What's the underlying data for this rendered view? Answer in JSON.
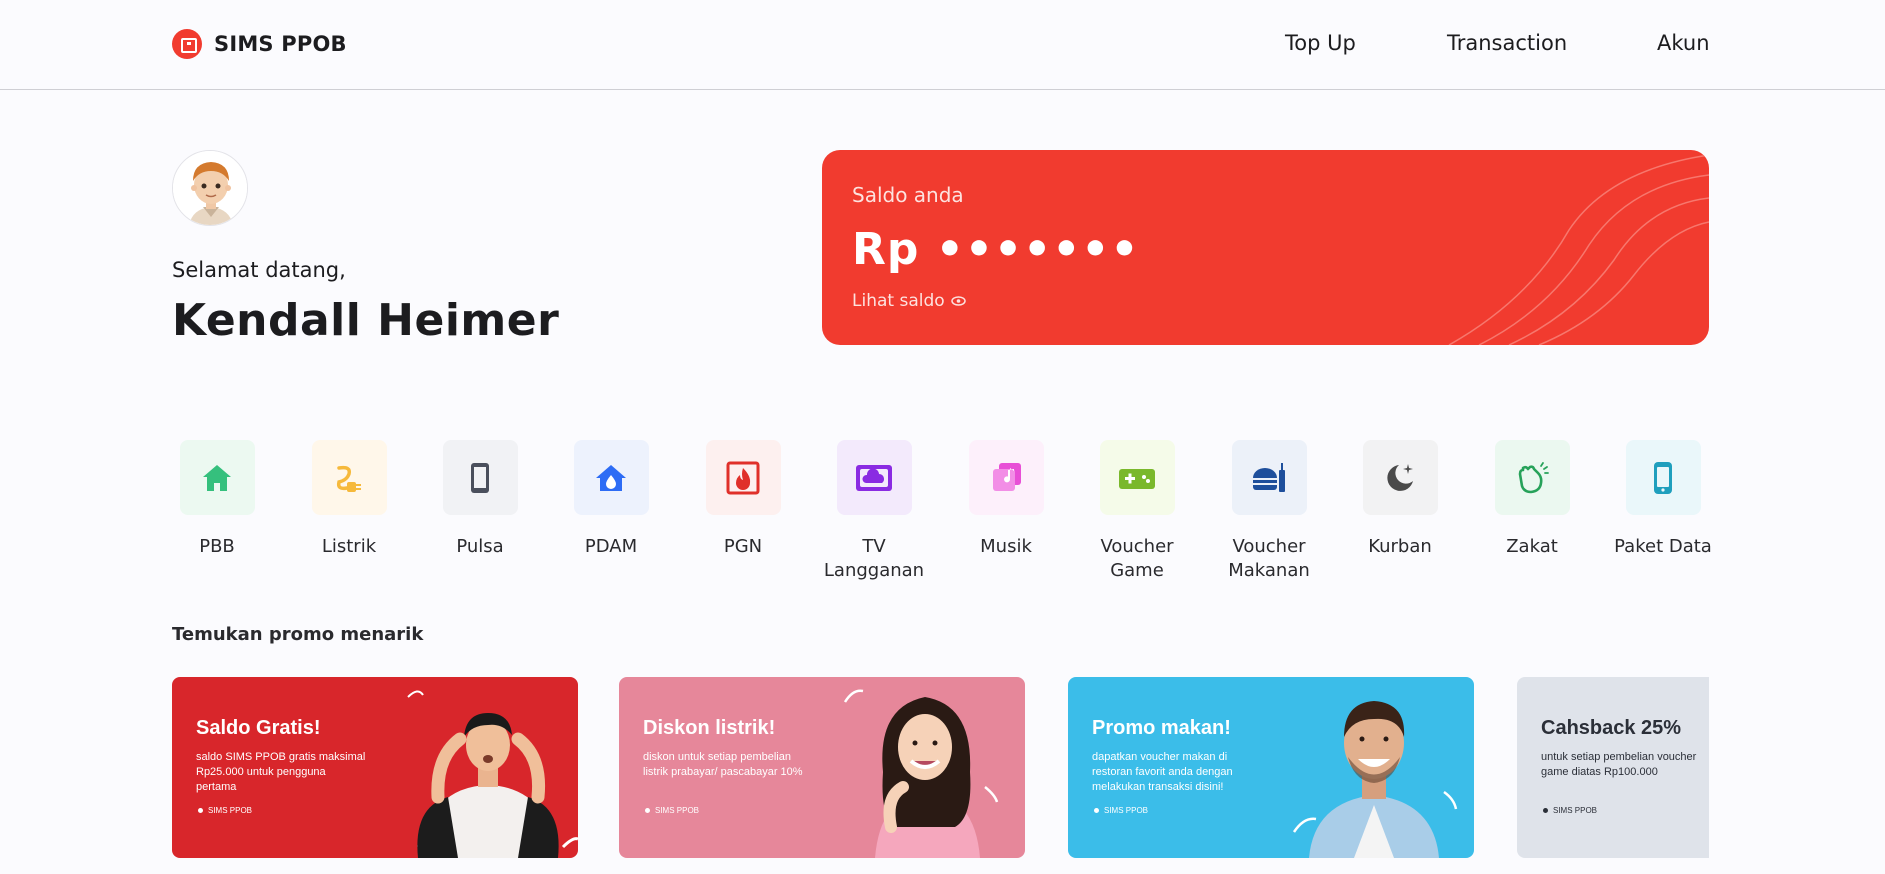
{
  "header": {
    "brand_name": "SIMS PPOB",
    "nav": [
      {
        "label": "Top Up"
      },
      {
        "label": "Transaction"
      },
      {
        "label": "Akun"
      }
    ]
  },
  "profile": {
    "greeting": "Selamat datang,",
    "name": "Kendall Heimer"
  },
  "balance": {
    "label": "Saldo anda",
    "value": "Rp •••••••",
    "toggle_label": "Lihat saldo",
    "toggle_icon": "eye-icon",
    "card_color": "#f13b2f"
  },
  "services": [
    {
      "label": "PBB",
      "icon": "house-icon",
      "color": "#35c07d",
      "bg": "#ecf9f1"
    },
    {
      "label": "Listrik",
      "icon": "plug-icon",
      "color": "#f6b93b",
      "bg": "#fff7ea"
    },
    {
      "label": "Pulsa",
      "icon": "phone-icon",
      "color": "#4a4f5c",
      "bg": "#f1f2f5"
    },
    {
      "label": "PDAM",
      "icon": "water-home-icon",
      "color": "#2d6cf5",
      "bg": "#edf2fd"
    },
    {
      "label": "PGN",
      "icon": "flame-icon",
      "color": "#e0302a",
      "bg": "#fdf0ef"
    },
    {
      "label": "TV Langganan",
      "icon": "tv-cloud-icon",
      "color": "#8a2be2",
      "bg": "#f3eafc"
    },
    {
      "label": "Musik",
      "icon": "music-icon",
      "color": "#e84fd6",
      "bg": "#fdf0fb"
    },
    {
      "label": "Voucher Game",
      "icon": "gamepad-icon",
      "color": "#7ab82b",
      "bg": "#f5fbe9"
    },
    {
      "label": "Voucher Makanan",
      "icon": "food-icon",
      "color": "#1e4f9c",
      "bg": "#ecf1f9"
    },
    {
      "label": "Kurban",
      "icon": "moon-star-icon",
      "color": "#4a4a4a",
      "bg": "#f2f2f3"
    },
    {
      "label": "Zakat",
      "icon": "hands-icon",
      "color": "#27a25a",
      "bg": "#ebf8f0"
    },
    {
      "label": "Paket Data",
      "icon": "mobile-data-icon",
      "color": "#1f9fbd",
      "bg": "#eaf7fa"
    }
  ],
  "promo": {
    "title": "Temukan promo menarik",
    "items": [
      {
        "heading": "Saldo Gratis!",
        "desc": "saldo SIMS PPOB gratis maksimal Rp25.000 untuk pengguna pertama",
        "tag": "SIMS PPOB",
        "bg": "#d8262b"
      },
      {
        "heading": "Diskon listrik!",
        "desc": "diskon untuk setiap pembelian listrik prabayar/ pascabayar 10%",
        "tag": "SIMS PPOB",
        "bg": "#e6879a"
      },
      {
        "heading": "Promo makan!",
        "desc": "dapatkan voucher makan di restoran favorit anda dengan melakukan transaksi disini!",
        "tag": "SIMS PPOB",
        "bg": "#3bbde9"
      },
      {
        "heading": "Cahsback 25%",
        "desc": "untuk setiap pembelian voucher game diatas Rp100.000",
        "tag": "SIMS PPOB",
        "bg": "#dfe3ea"
      }
    ]
  }
}
